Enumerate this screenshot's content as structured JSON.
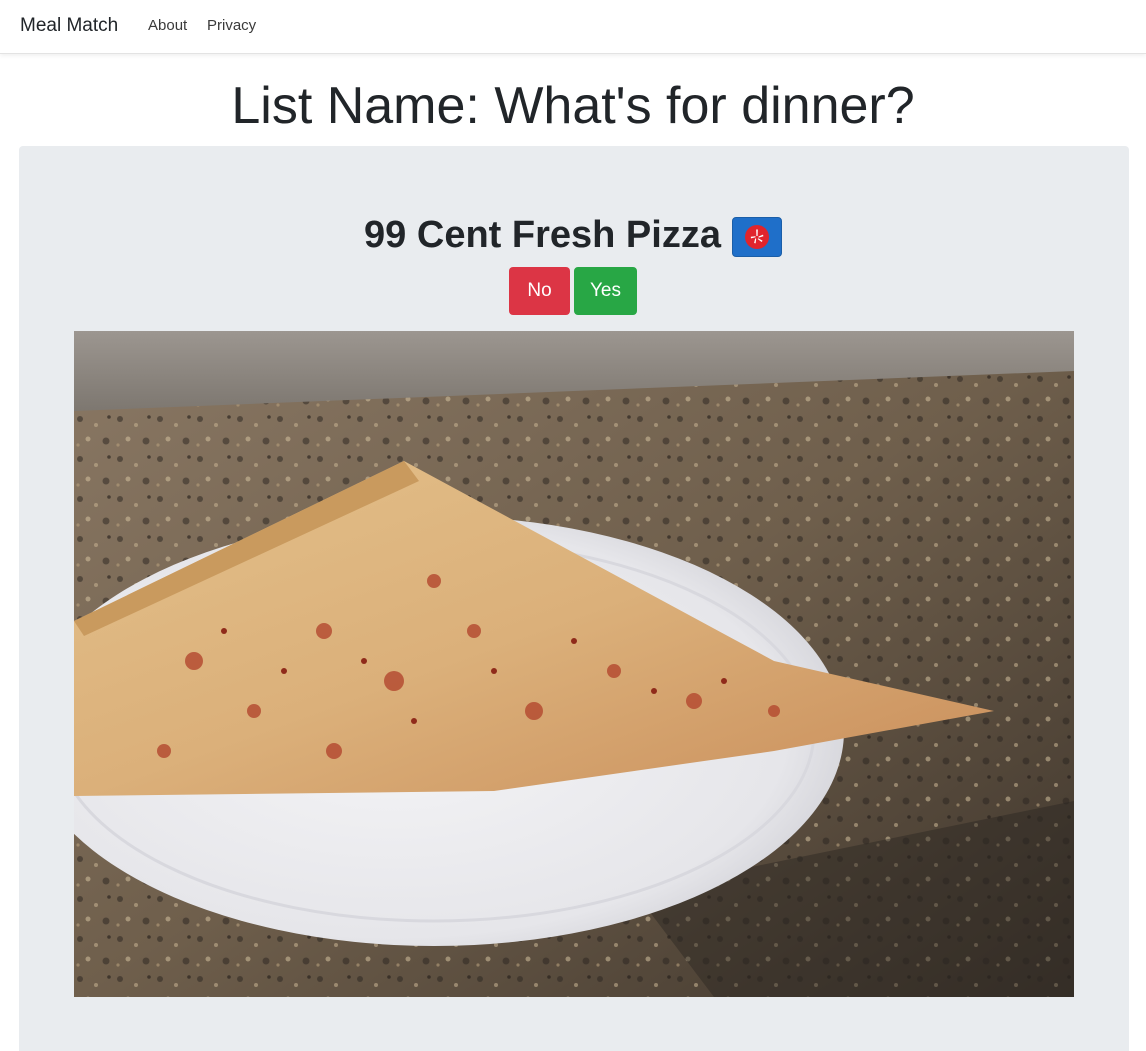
{
  "navbar": {
    "brand": "Meal Match",
    "links": [
      "About",
      "Privacy"
    ]
  },
  "page": {
    "title": "List Name: What's for dinner?"
  },
  "restaurant": {
    "name": "99 Cent Fresh Pizza",
    "link_icon": "yelp-icon",
    "photo_icon": "pizza-slice-photo"
  },
  "actions": {
    "no_label": "No",
    "yes_label": "Yes"
  },
  "colors": {
    "no": "#dc3545",
    "yes": "#28a745",
    "yelp_button": "#1f6fc9",
    "jumbotron": "#e9ecef"
  }
}
